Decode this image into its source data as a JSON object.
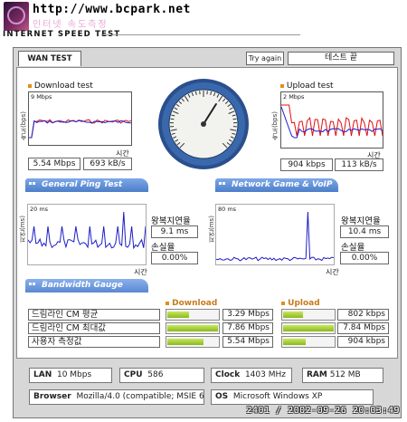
{
  "header": {
    "url": "http://www.bcpark.net",
    "subtitle": "인터넷 속도측정",
    "brand": "INTERNET SPEED TEST"
  },
  "tabs": {
    "active": "WAN TEST"
  },
  "toolbar": {
    "try_again": "Try again",
    "status": "테스트 끝"
  },
  "download": {
    "title": "Download test",
    "ylabel": "속도(bps)",
    "scale": "9 Mbps",
    "time_label": "시간",
    "mbps": "5.54 Mbps",
    "kbs": "693 kB/s"
  },
  "upload": {
    "title": "Upload test",
    "ylabel": "속도(bps)",
    "scale": "2 Mbps",
    "time_label": "시간",
    "kbps": "904 kbps",
    "kbs": "113 kB/s"
  },
  "ping": {
    "tab": "General Ping Test",
    "ylabel": "지연(ms)",
    "scale": "20 ms",
    "time_label": "시간",
    "rtt_label": "왕복지연율",
    "rtt": "9.1 ms",
    "loss_label": "손실율",
    "loss": "0.00%"
  },
  "voip": {
    "tab": "Network Game & VoIP Test",
    "ylabel": "지연(ms)",
    "scale": "80 ms",
    "time_label": "시간",
    "rtt_label": "왕복지연율",
    "rtt": "10.4 ms",
    "loss_label": "손실율",
    "loss": "0.00%"
  },
  "bandwidth": {
    "tab": "Bandwidth Gauge",
    "download_header": "Download",
    "upload_header": "Upload",
    "rows": [
      {
        "label": "드림라인 CM 평균",
        "down": "3.29 Mbps",
        "up": "802 kbps",
        "down_frac": 0.42,
        "up_frac": 0.4
      },
      {
        "label": "드림라인 CM 최대값",
        "down": "7.86 Mbps",
        "up": "7.84 Mbps",
        "down_frac": 1.0,
        "up_frac": 1.0
      },
      {
        "label": "사용자 측정값",
        "down": "5.54 Mbps",
        "up": "904 kbps",
        "down_frac": 0.72,
        "up_frac": 0.45
      }
    ]
  },
  "info": {
    "lan_label": "LAN",
    "lan": "10 Mbps",
    "cpu_label": "CPU",
    "cpu": "586",
    "clock_label": "Clock",
    "clock": "1403 MHz",
    "ram_label": "RAM",
    "ram": "512 MB",
    "browser_label": "Browser",
    "browser": "Mozilla/4.0 (compatible; MSIE 6.0",
    "os_label": "OS",
    "os": "Microsoft Windows XP"
  },
  "footer": {
    "datetime": "2401 / 2002-09-26 20:03:49"
  },
  "colors": {
    "accent_orange": "#e88a1c",
    "tab_blue": "#4c7ec8",
    "bar_green": "#a4d034"
  },
  "gauge": {
    "needle_fraction": 0.62
  }
}
